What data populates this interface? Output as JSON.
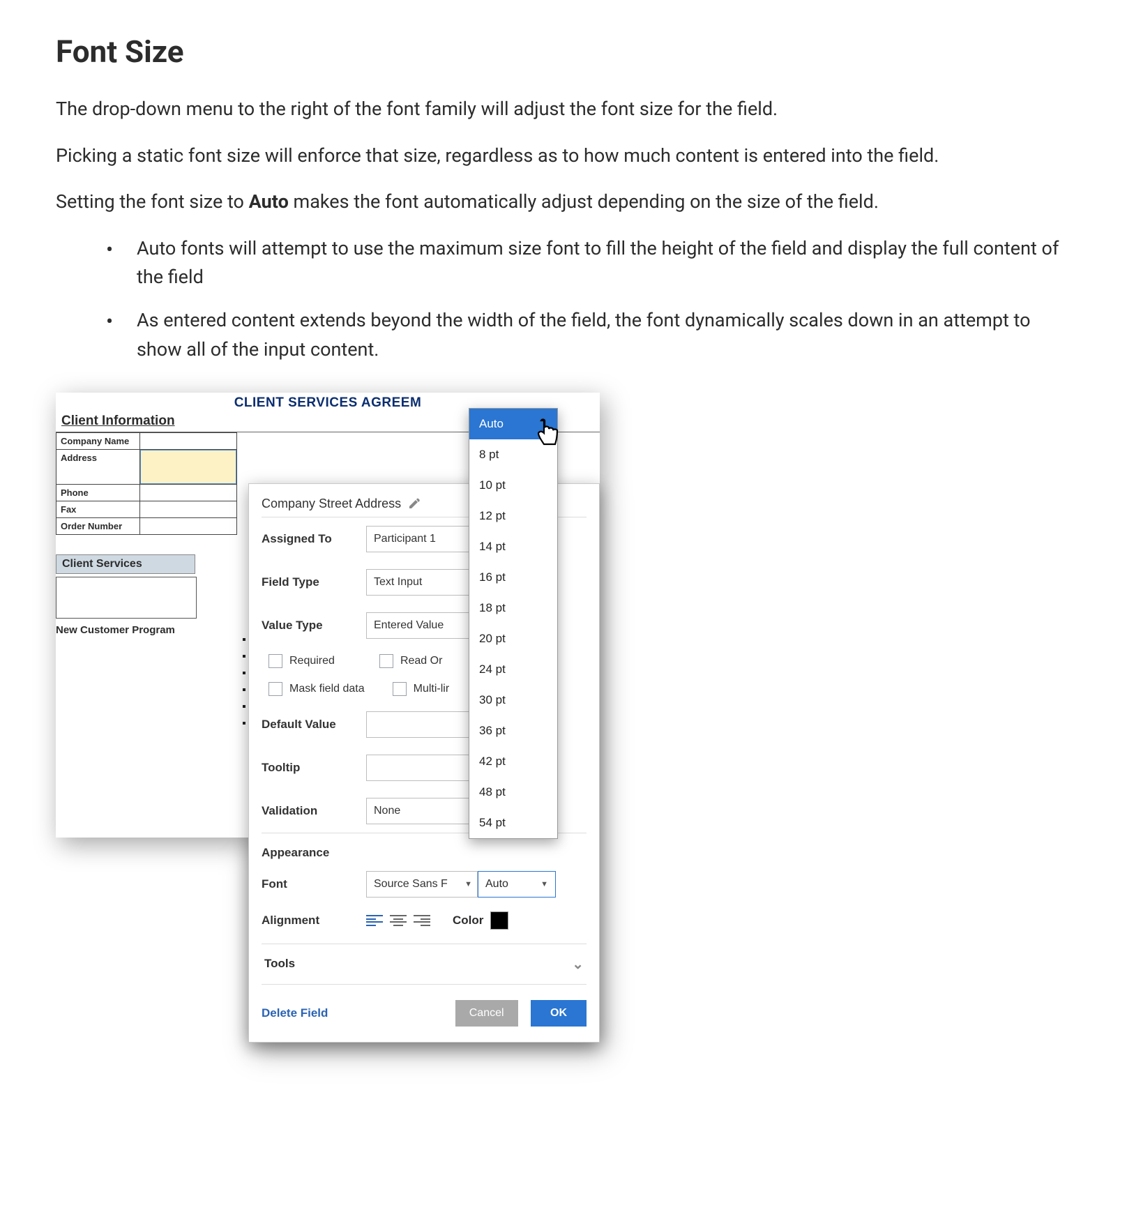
{
  "heading": "Font Size",
  "paragraphs": {
    "p1": "The drop-down menu to the right of the font family will adjust the font size for the field.",
    "p2": "Picking a static font size will enforce that size, regardless as to how much content is entered into the field.",
    "p3_a": "Setting the font size to ",
    "p3_b": "Auto",
    "p3_c": " makes the font automatically adjust depending on the size of the field."
  },
  "bullets": {
    "b1": "Auto fonts will attempt to use the maximum size font to fill the height of the field and display the full content of the field",
    "b2": "As entered content extends beyond the width of the field, the font dynamically scales down in an attempt to show all of the input content."
  },
  "doc": {
    "title": "CLIENT SERVICES AGREEM",
    "section": "Client Information",
    "rows": {
      "company": "Company Name",
      "address": "Address",
      "phone": "Phone",
      "fax": "Fax",
      "order": "Order Number"
    },
    "services": "Client Services",
    "newcust": "New Customer Program"
  },
  "panel": {
    "title": "Company Street Address",
    "assigned_to_label": "Assigned To",
    "assigned_to_value": "Participant 1",
    "field_type_label": "Field Type",
    "field_type_value": "Text Input",
    "value_type_label": "Value Type",
    "value_type_value": "Entered Value",
    "required_label": "Required",
    "readonly_label": "Read Or",
    "mask_label": "Mask field data",
    "multiline_label": "Multi-lir",
    "default_label": "Default Value",
    "tooltip_label": "Tooltip",
    "validation_label": "Validation",
    "validation_value": "None",
    "appearance_label": "Appearance",
    "font_label": "Font",
    "font_value": "Source Sans F",
    "size_value": "Auto",
    "alignment_label": "Alignment",
    "color_label": "Color",
    "tools_label": "Tools",
    "delete_label": "Delete Field",
    "cancel_label": "Cancel",
    "ok_label": "OK"
  },
  "dropdown": {
    "opt0": "Auto",
    "opt1": "8 pt",
    "opt2": "10 pt",
    "opt3": "12 pt",
    "opt4": "14 pt",
    "opt5": "16 pt",
    "opt6": "18 pt",
    "opt7": "20 pt",
    "opt8": "24 pt",
    "opt9": "30 pt",
    "opt10": "36 pt",
    "opt11": "42 pt",
    "opt12": "48 pt",
    "opt13": "54 pt"
  }
}
